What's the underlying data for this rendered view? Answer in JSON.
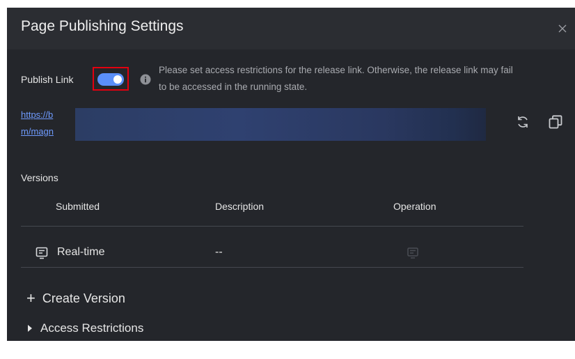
{
  "dialog": {
    "title": "Page Publishing Settings"
  },
  "publish": {
    "label": "Publish Link",
    "enabled": true,
    "notice": "Please set access restrictions for the release link. Otherwise, the release link may fail to be accessed in the running state.",
    "link_line1": "https://b",
    "link_line2": "m/magn"
  },
  "versions": {
    "label": "Versions",
    "columns": [
      "Submitted",
      "Description",
      "Operation"
    ],
    "rows": [
      {
        "submitted": "Real-time",
        "description": "--"
      }
    ]
  },
  "actions": {
    "create_version": "Create Version",
    "access_restrictions": "Access Restrictions"
  },
  "colors": {
    "background": "#24262b",
    "accent": "#5b8ff9",
    "link": "#6f9bff",
    "highlight": "#e3000f"
  }
}
